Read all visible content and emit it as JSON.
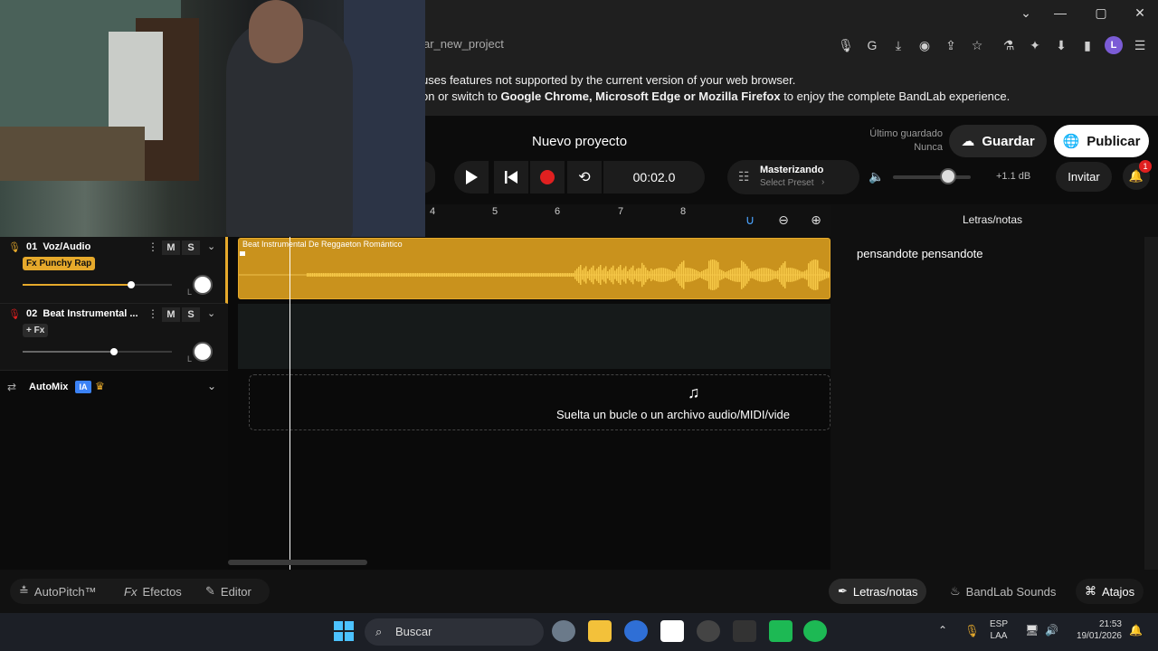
{
  "browser": {
    "url": "ar_new_project",
    "warning_line1": "uses features not supported by the current version of your web browser.",
    "warning_line2_pre": "on or switch to ",
    "warning_line2_bold": "Google Chrome, Microsoft Edge or Mozilla Firefox",
    "warning_line2_post": " to enjoy the complete BandLab experience.",
    "profile_initial": "L"
  },
  "header": {
    "project_title": "Nuevo proyecto",
    "last_saved_label": "Último guardado",
    "last_saved_value": "Nunca",
    "save_label": "Guardar",
    "publish_label": "Publicar",
    "time": "00:02.0",
    "mastering_title": "Masterizando",
    "mastering_preset": "Select Preset",
    "volume_db": "+1.1 dB",
    "volume_level": 0.7,
    "invite_label": "Invitar",
    "notifications_count": "1"
  },
  "ruler": {
    "marks": [
      "4",
      "5",
      "6",
      "7",
      "8"
    ]
  },
  "tracks": [
    {
      "number": "01",
      "name": "Voz/Audio",
      "fx": "Fx Punchy Rap",
      "mute": "M",
      "solo": "S",
      "volume": 0.8,
      "pan_label": "L"
    },
    {
      "number": "02",
      "name": "Beat Instrumental ...",
      "fx": "+ Fx",
      "mute": "M",
      "solo": "S",
      "volume": 0.67,
      "pan_label": "L"
    }
  ],
  "automix": {
    "label": "AutoMix",
    "badge": "IA"
  },
  "clip": {
    "title": "Beat Instrumental De Reggaeton Romántico"
  },
  "drop_zone": {
    "text": "Suelta un bucle o un archivo audio/MIDI/vide"
  },
  "lyrics": {
    "title": "Letras/notas",
    "text": "pensandote pensandote"
  },
  "bottom": {
    "autopitch": "AutoPitch™",
    "effects": "Efectos",
    "editor": "Editor",
    "lyrics_tab": "Letras/notas",
    "sounds_tab": "BandLab Sounds",
    "shortcuts": "Atajos"
  },
  "taskbar": {
    "search_placeholder": "Buscar",
    "lang": "ESP",
    "layout": "LAA",
    "time": "21:53",
    "date": "19/01/2026"
  },
  "colors": {
    "accent": "#e6a92b",
    "record": "#e02020",
    "magnet": "#4ba3ff"
  }
}
